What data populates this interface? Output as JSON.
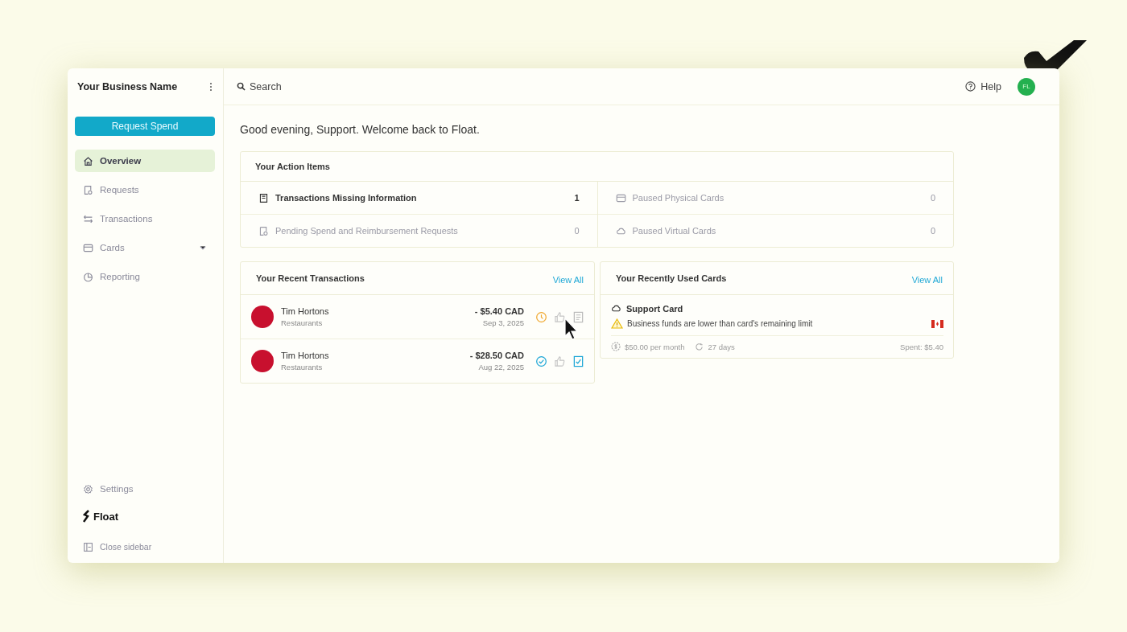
{
  "sidebar": {
    "business_name": "Your Business Name",
    "request_button": "Request Spend",
    "items": [
      {
        "label": "Overview",
        "kind": "home",
        "selected": true
      },
      {
        "label": "Requests",
        "kind": "request",
        "selected": false
      },
      {
        "label": "Transactions",
        "kind": "arrows",
        "selected": false
      },
      {
        "label": "Cards",
        "kind": "card",
        "selected": false,
        "expanded": false
      },
      {
        "label": "Reporting",
        "kind": "pie",
        "selected": false
      }
    ],
    "settings": "Settings",
    "brand": "Float",
    "close": "Close sidebar"
  },
  "topbar": {
    "search": "Search",
    "help": "Help",
    "avatar": "FL"
  },
  "greeting": "Good evening, Support. Welcome back to Float.",
  "action_items": {
    "title": "Your Action Items",
    "columns": [
      [
        {
          "label": "Transactions Missing Information",
          "count": "1",
          "kind": "receipt",
          "active": true
        },
        {
          "label": "Pending Spend and Reimbursement Requests",
          "count": "0",
          "kind": "request",
          "active": false
        }
      ],
      [
        {
          "label": "Paused Physical Cards",
          "count": "0",
          "kind": "card",
          "active": false
        },
        {
          "label": "Paused Virtual Cards",
          "count": "0",
          "kind": "cloud",
          "active": false
        }
      ]
    ]
  },
  "transactions": {
    "title": "Your Recent Transactions",
    "view_all": "View All",
    "rows": [
      {
        "merchant": "Tim Hortons",
        "category": "Restaurants",
        "amount": "- $5.40 CAD",
        "date": "Sep 3, 2025",
        "kind": "pending",
        "receipt_attached": false
      },
      {
        "merchant": "Tim Hortons",
        "category": "Restaurants",
        "amount": "- $28.50 CAD",
        "date": "Aug 22, 2025",
        "kind": "approved",
        "receipt_attached": true
      }
    ]
  },
  "cards": {
    "title": "Your Recently Used Cards",
    "view_all": "View All",
    "items": [
      {
        "name": "Support Card",
        "warning": "Business funds are lower than card's remaining limit",
        "limit": "$50.00 per month",
        "reset": "27 days",
        "spent": "Spent: $5.40"
      }
    ]
  }
}
